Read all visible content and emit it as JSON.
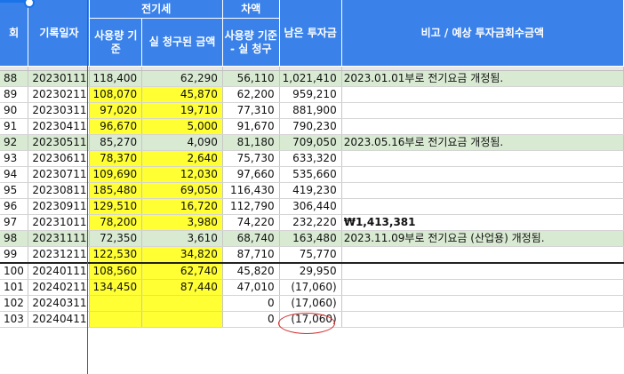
{
  "headers": {
    "no": "회",
    "date": "기록일자",
    "electricity": "전기세",
    "usage_basis": "사용량 기준",
    "actual_billed": "실 청구된 금액",
    "difference": "차액",
    "diff_desc": "사용량 기준 - 실 청구",
    "remaining": "남은 투자금",
    "notes": "비고 / 예상 투자금회수금액"
  },
  "rows": [
    {
      "no": "88",
      "date": "20230111",
      "usage": "118,400",
      "billed": "62,290",
      "diff": "56,110",
      "remain": "1,021,410",
      "note": "2023.01.01부로 전기요금 개정됨.",
      "green": true,
      "yellow": false
    },
    {
      "no": "89",
      "date": "20230211",
      "usage": "108,070",
      "billed": "45,870",
      "diff": "62,200",
      "remain": "959,210",
      "note": "",
      "green": false,
      "yellow": true
    },
    {
      "no": "90",
      "date": "20230311",
      "usage": "97,020",
      "billed": "19,710",
      "diff": "77,310",
      "remain": "881,900",
      "note": "",
      "green": false,
      "yellow": true
    },
    {
      "no": "91",
      "date": "20230411",
      "usage": "96,670",
      "billed": "5,000",
      "diff": "91,670",
      "remain": "790,230",
      "note": "",
      "green": false,
      "yellow": true
    },
    {
      "no": "92",
      "date": "20230511",
      "usage": "85,270",
      "billed": "4,090",
      "diff": "81,180",
      "remain": "709,050",
      "note": "2023.05.16부로 전기요금 개정됨.",
      "green": true,
      "yellow": false
    },
    {
      "no": "93",
      "date": "20230611",
      "usage": "78,370",
      "billed": "2,640",
      "diff": "75,730",
      "remain": "633,320",
      "note": "",
      "green": false,
      "yellow": true
    },
    {
      "no": "94",
      "date": "20230711",
      "usage": "109,690",
      "billed": "12,030",
      "diff": "97,660",
      "remain": "535,660",
      "note": "",
      "green": false,
      "yellow": true
    },
    {
      "no": "95",
      "date": "20230811",
      "usage": "185,480",
      "billed": "69,050",
      "diff": "116,430",
      "remain": "419,230",
      "note": "",
      "green": false,
      "yellow": true
    },
    {
      "no": "96",
      "date": "20230911",
      "usage": "129,510",
      "billed": "16,720",
      "diff": "112,790",
      "remain": "306,440",
      "note": "",
      "green": false,
      "yellow": true
    },
    {
      "no": "97",
      "date": "20231011",
      "usage": "78,200",
      "billed": "3,980",
      "diff": "74,220",
      "remain": "232,220",
      "note": "₩1,413,381",
      "green": false,
      "yellow": true,
      "note_bold": true
    },
    {
      "no": "98",
      "date": "20231111",
      "usage": "72,350",
      "billed": "3,610",
      "diff": "68,740",
      "remain": "163,480",
      "note": "2023.11.09부로 전기요금 (산업용) 개정됨.",
      "green": true,
      "yellow": false
    },
    {
      "no": "99",
      "date": "20231211",
      "usage": "122,530",
      "billed": "34,820",
      "diff": "87,710",
      "remain": "75,770",
      "note": "",
      "green": false,
      "yellow": true,
      "thick": true
    },
    {
      "no": "100",
      "date": "20240111",
      "usage": "108,560",
      "billed": "62,740",
      "diff": "45,820",
      "remain": "29,950",
      "note": "",
      "green": false,
      "yellow": true
    },
    {
      "no": "101",
      "date": "20240211",
      "usage": "134,450",
      "billed": "87,440",
      "diff": "47,010",
      "remain": "(17,060)",
      "note": "",
      "green": false,
      "yellow": true
    },
    {
      "no": "102",
      "date": "20240311",
      "usage": "",
      "billed": "",
      "diff": "0",
      "remain": "(17,060)",
      "note": "",
      "green": false,
      "yellow": true
    },
    {
      "no": "103",
      "date": "20240411",
      "usage": "",
      "billed": "",
      "diff": "0",
      "remain": "(17,060)",
      "note": "",
      "green": false,
      "yellow": true
    }
  ],
  "colors": {
    "header_blue": "#3a82ea",
    "highlight_yellow": "#ffff33",
    "revision_green": "#d9ead3",
    "annotation_red": "#d12c2c"
  }
}
